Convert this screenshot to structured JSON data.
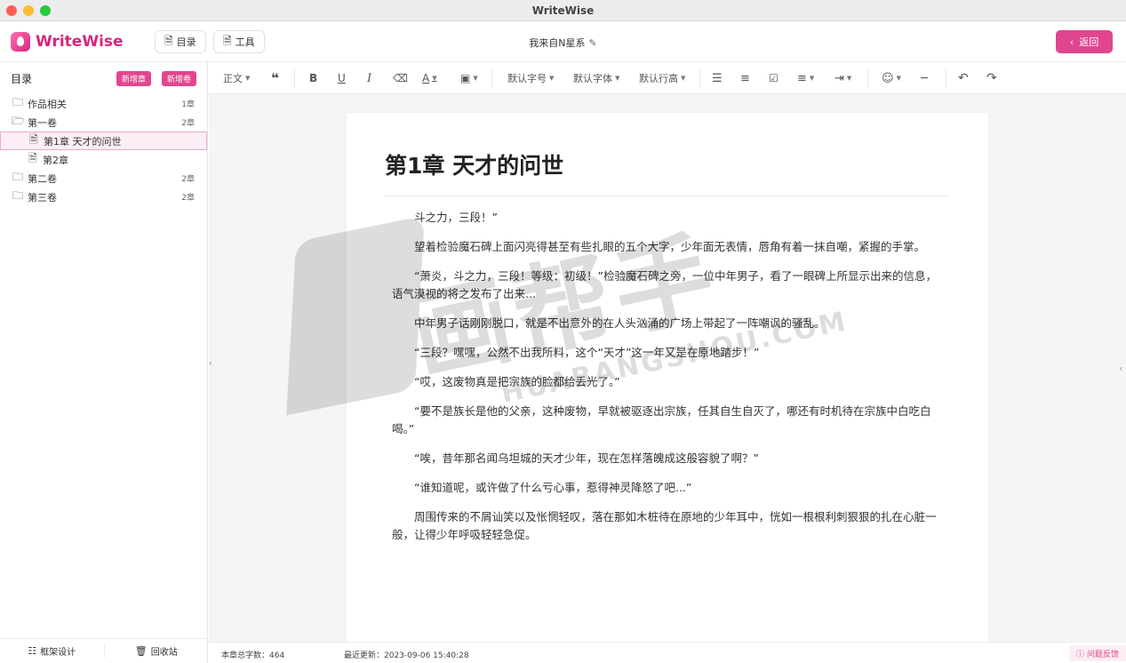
{
  "window": {
    "title": "WriteWise"
  },
  "header": {
    "logo_text": "WriteWise",
    "catalog_button": "目录",
    "tools_button": "工具",
    "doc_title": "我来自N星系",
    "back_button": "返回"
  },
  "sidebar": {
    "title": "目录",
    "add_chapter": "新增章",
    "add_volume": "新增卷",
    "tree": [
      {
        "label": "作品相关",
        "count": "1章",
        "type": "folder",
        "level": 0
      },
      {
        "label": "第一卷",
        "count": "2章",
        "type": "folder-open",
        "level": 0
      },
      {
        "label": "第1章 天才的问世",
        "count": "",
        "type": "file",
        "level": 1,
        "selected": true
      },
      {
        "label": "第2章",
        "count": "",
        "type": "file",
        "level": 1
      },
      {
        "label": "第二卷",
        "count": "2章",
        "type": "folder",
        "level": 0
      },
      {
        "label": "第三卷",
        "count": "2章",
        "type": "folder",
        "level": 0
      }
    ],
    "footer_framework": "框架设计",
    "footer_recycle": "回收站"
  },
  "toolbar": {
    "paragraph_style": "正文",
    "font_size": "默认字号",
    "font_family": "默认字体",
    "line_height": "默认行高",
    "bold": "B",
    "underline": "U",
    "italic": "I",
    "font_color": "A"
  },
  "editor": {
    "chapter_title": "第1章 天才的问世",
    "paragraphs": [
      "斗之力，三段！”",
      "望着检验魔石碑上面闪亮得甚至有些扎眼的五个大字，少年面无表情，唇角有着一抹自嘲，紧握的手掌。",
      "“萧炎，斗之力，三段！等级：初级！”检验魔石碑之旁，一位中年男子，看了一眼碑上所显示出来的信息，语气漠视的将之发布了出来...",
      "中年男子话刚刚脱口，就是不出意外的在人头汹涌的广场上带起了一阵嘲讽的骚乱。",
      "“三段？嘿嘿，公然不出我所料，这个“天才”这一年又是在原地踏步！”",
      "“哎，这废物真是把宗族的脸都给丢光了。”",
      "“要不是族长是他的父亲，这种废物，早就被驱逐出宗族，任其自生自灭了，哪还有时机待在宗族中白吃白喝。”",
      "“唉，昔年那名闻乌坦城的天才少年，现在怎样落魄成这般容貌了啊？”",
      "“谁知道呢，或许做了什么亏心事，惹得神灵降怒了吧...”",
      "周围传来的不屑讪笑以及怅惘轻叹，落在那如木桩待在原地的少年耳中，恍如一根根利刺狠狠的扎在心脏一般，让得少年呼吸轻轻急促。"
    ]
  },
  "status": {
    "word_count": "本章总字数：464",
    "last_update": "最近更新：2023-09-06 15:40:28",
    "feedback": "问题反馈"
  },
  "watermark": {
    "cn": "画帮手",
    "en": "HUABANGSHOU.COM"
  },
  "colors": {
    "accent": "#e0468f",
    "accent_light": "#fdeef5"
  }
}
